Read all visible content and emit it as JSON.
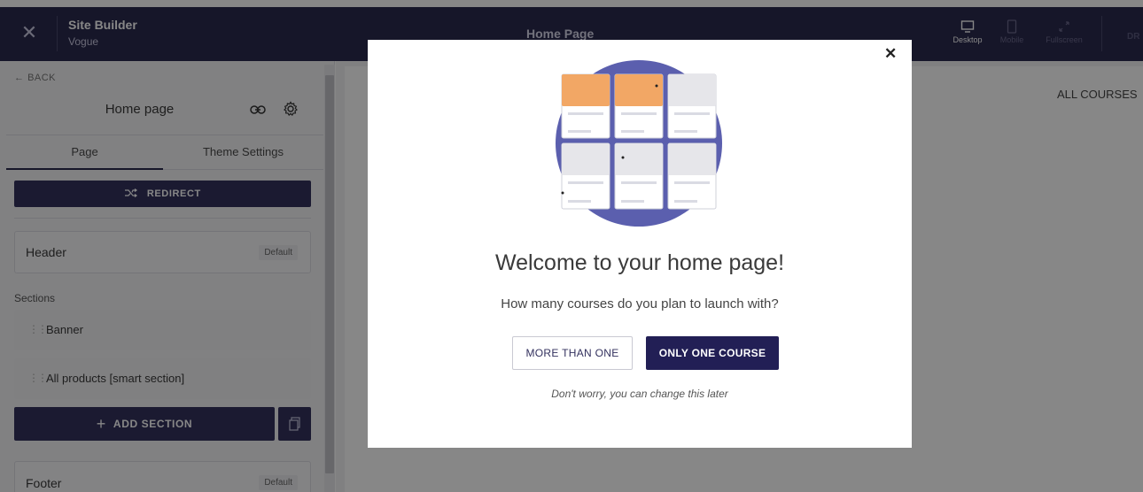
{
  "header": {
    "app_title": "Site Builder",
    "app_subtitle": "Vogue",
    "page_title": "Home Page",
    "devices": [
      {
        "label": "Desktop",
        "icon": "desktop-icon",
        "active": true
      },
      {
        "label": "Mobile",
        "icon": "mobile-icon",
        "active": false
      },
      {
        "label": "Fullscreen",
        "icon": "fullscreen-icon",
        "active": false
      }
    ],
    "truncated_right_label": "DR"
  },
  "sidebar": {
    "back_label": "BACK",
    "title": "Home page",
    "tabs": [
      "Page",
      "Theme Settings"
    ],
    "active_tab": "Page",
    "redirect_label": "REDIRECT",
    "header_card": {
      "label": "Header",
      "badge": "Default"
    },
    "sections_label": "Sections",
    "sections": [
      {
        "name": "Banner"
      },
      {
        "name": "All products [smart section]"
      }
    ],
    "add_section_label": "ADD SECTION",
    "footer_card": {
      "label": "Footer",
      "badge": "Default"
    }
  },
  "preview": {
    "nav_link": "ALL COURSES"
  },
  "modal": {
    "title": "Welcome to your home page!",
    "question": "How many courses do you plan to launch with?",
    "option_more": "MORE THAN ONE",
    "option_one": "ONLY ONE COURSE",
    "note": "Don't worry, you can change this later"
  },
  "colors": {
    "header_bg": "#2b2a4f",
    "primary_button": "#33315e",
    "modal_primary": "#221f55",
    "illustration_circle": "#5b5fae",
    "illustration_accent": "#f2a765"
  }
}
